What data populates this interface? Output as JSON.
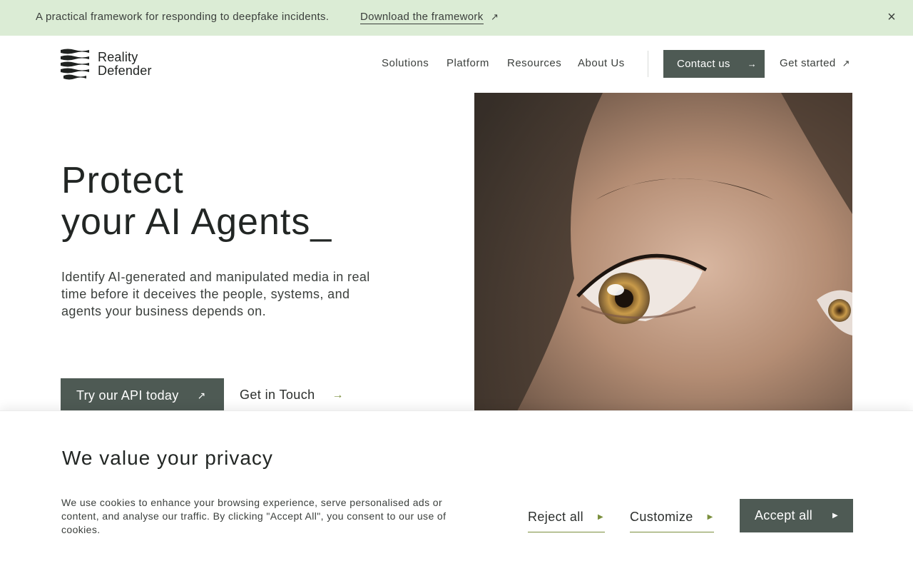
{
  "announcement": {
    "text": "A practical framework for responding to deepfake incidents.",
    "link_label": "Download the framework",
    "link_arrow": "↗",
    "close_label": "×"
  },
  "logo": {
    "line1": "Reality",
    "line2": "Defender"
  },
  "nav": {
    "items": [
      {
        "label": "Solutions"
      },
      {
        "label": "Platform"
      },
      {
        "label": "Resources"
      },
      {
        "label": "About Us"
      }
    ],
    "contact_label": "Contact us",
    "contact_arrow": "→",
    "get_started_label": "Get started",
    "get_started_arrow": "↗"
  },
  "hero": {
    "title_line1": "Protect",
    "title_line2": "your AI Agents_",
    "subtitle": "Identify AI-generated and manipulated media in real time before it deceives the people, systems, and agents your business depends on.",
    "primary_cta": "Try our API today",
    "primary_arrow": "↗",
    "secondary_cta": "Get in Touch",
    "secondary_arrow": "→"
  },
  "cookie": {
    "title": "We value your privacy",
    "text": "We use cookies to enhance your browsing experience, serve personalised ads or content, and analyse our traffic. By clicking \"Accept All\", you consent to our use of cookies.",
    "reject_label": "Reject all",
    "customize_label": "Customize",
    "accept_label": "Accept all",
    "arrow": "▶"
  },
  "colors": {
    "announce_bg": "#dbecd5",
    "button_bg": "#4e5a54",
    "accent_green": "#7a8f3c",
    "text_dark": "#222624"
  }
}
